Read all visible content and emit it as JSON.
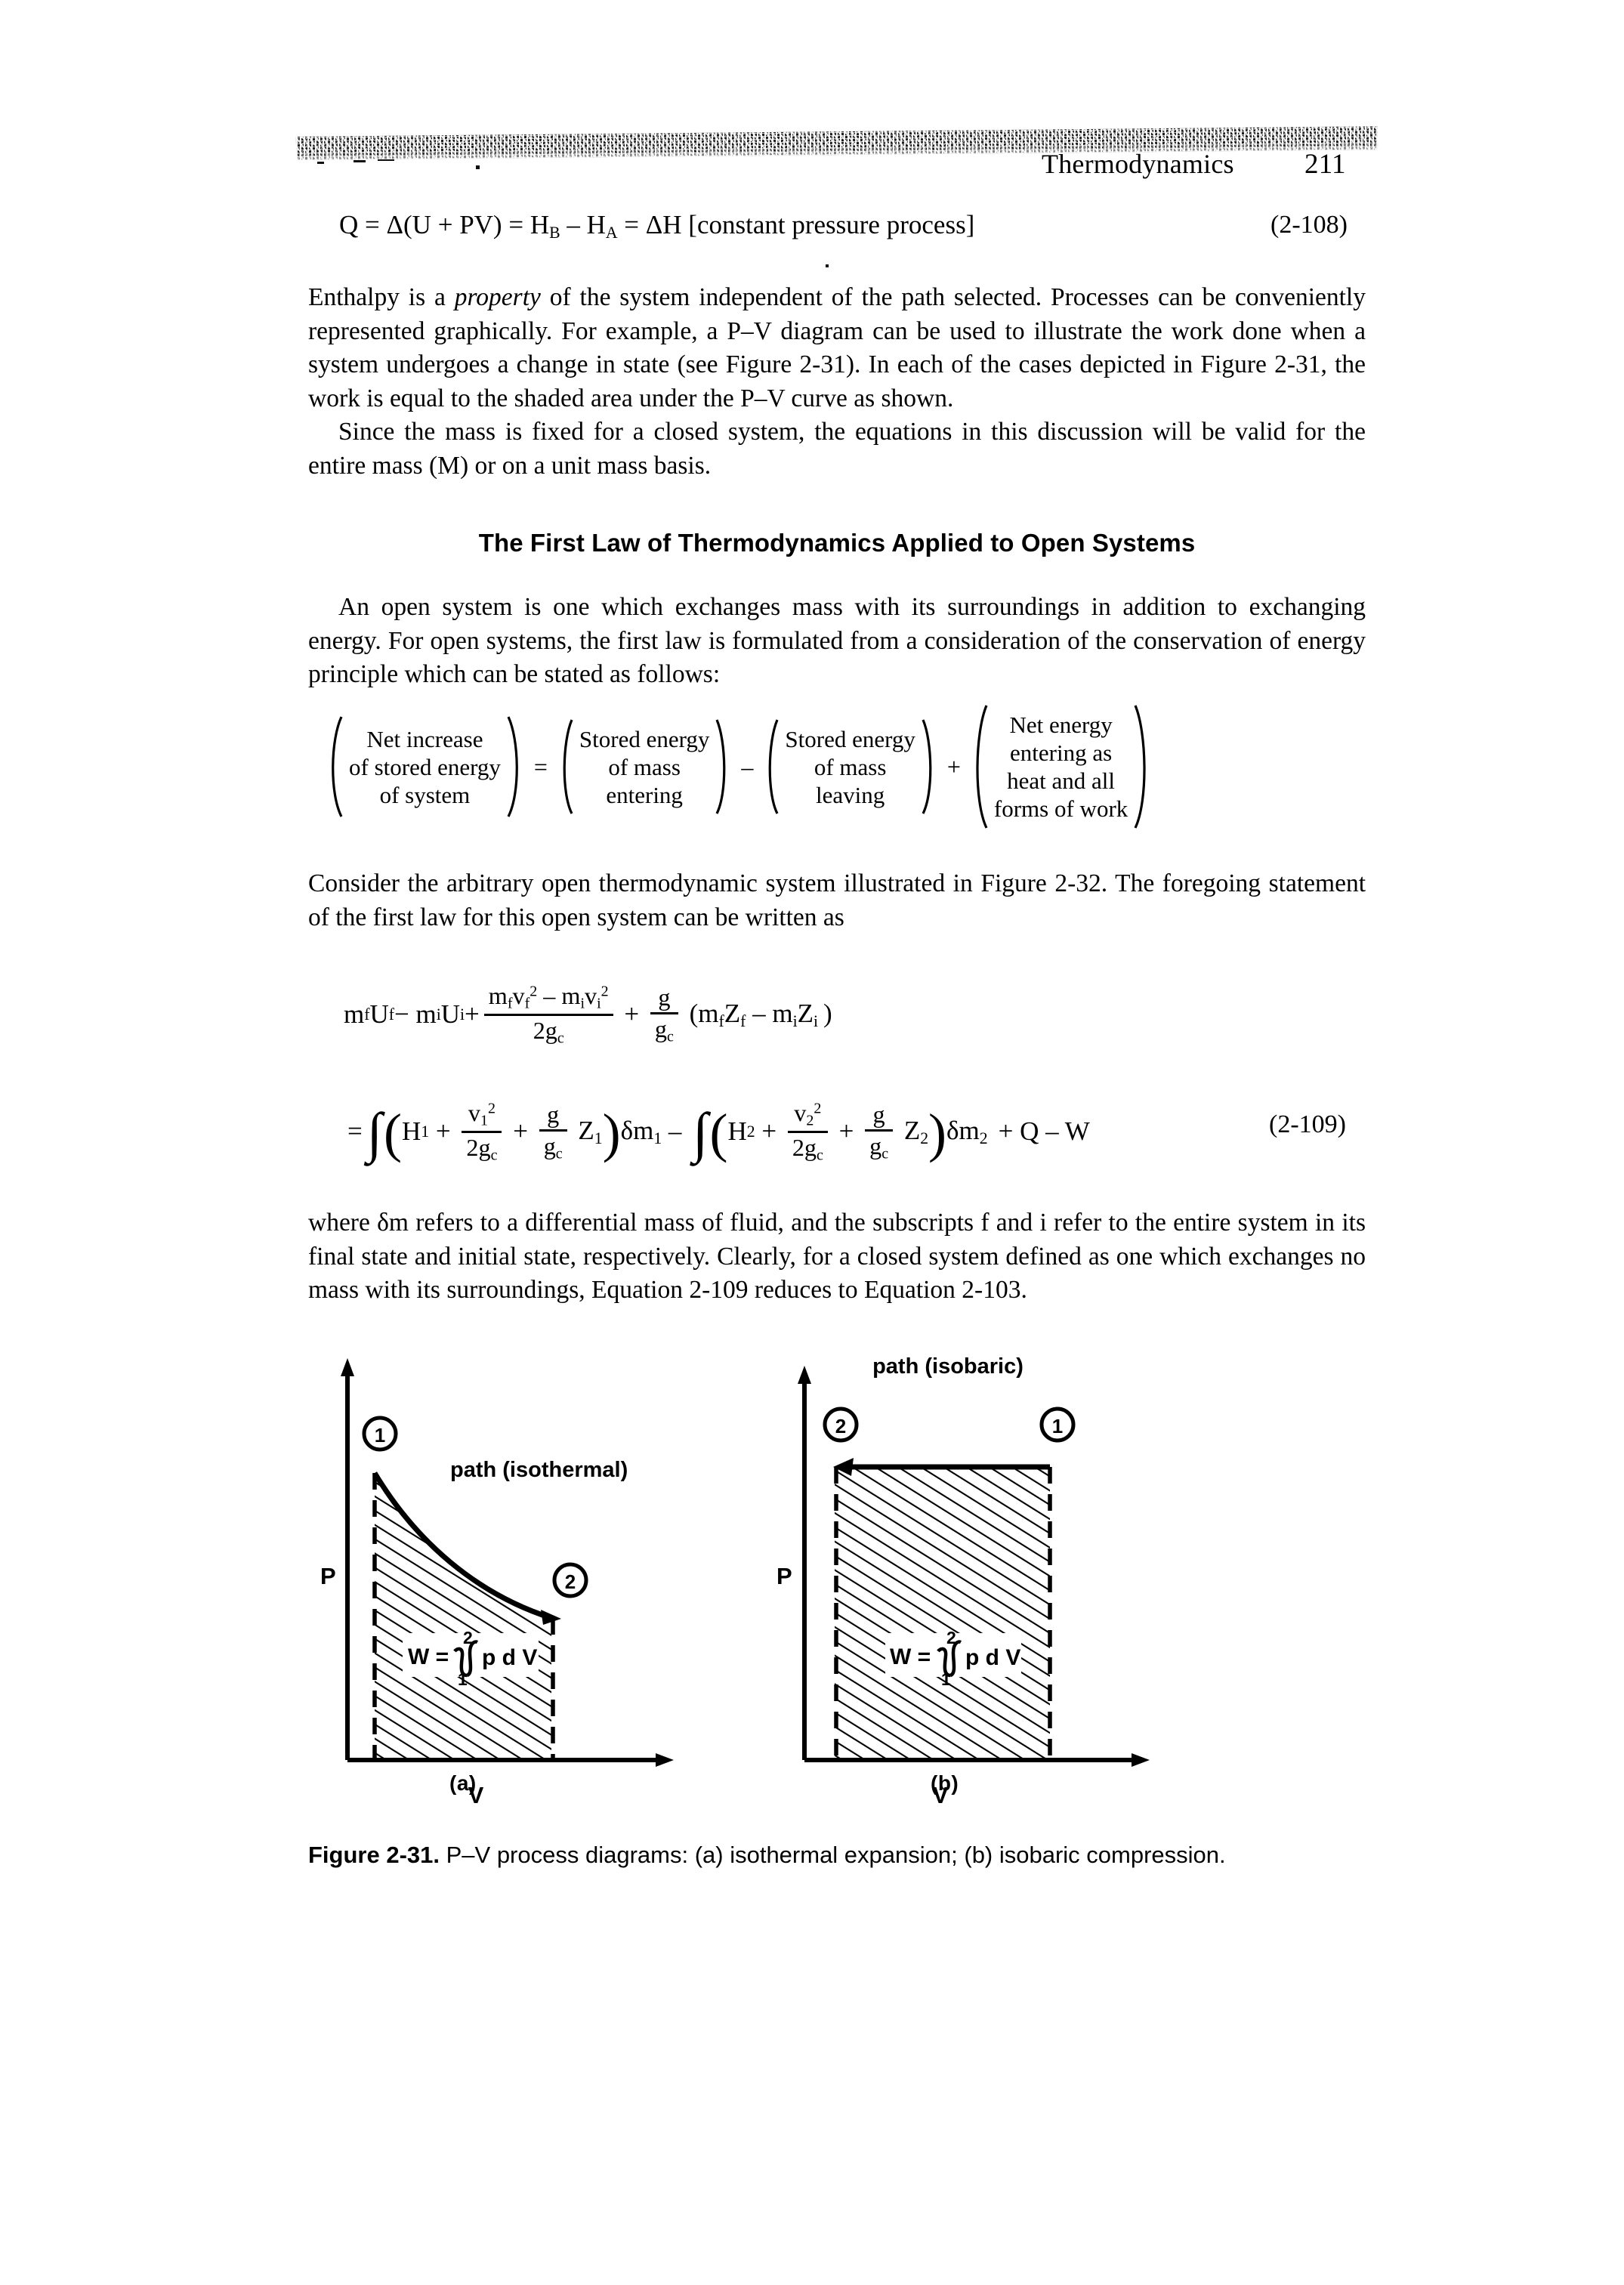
{
  "page": {
    "running_head": "Thermodynamics",
    "page_number": "211"
  },
  "equations": {
    "eq_2_108": {
      "text": "Q = Δ(U + PV) = H_B − H_A = ΔH [constant pressure process]",
      "lead": "Q = Δ(U + PV) = H",
      "sub_b": "B",
      "minus": " – H",
      "sub_a": "A",
      "tail": " = ΔH [constant pressure process]",
      "number": "(2-108)"
    },
    "eq_2_109": {
      "number": "(2-109)",
      "line1": {
        "t1": "m",
        "s1": "f",
        "t2": "U",
        "s2": "f",
        "t3": " − m",
        "s3": "i",
        "t4": "U",
        "s4": "i",
        "t5": " + ",
        "frac_num": "m_f v_f² − m_i v_i²",
        "frac_den": "2g_c",
        "t6": " + ",
        "frac2_num": "g",
        "frac2_den": "g_c",
        "t7": "(m_f Z_f − m_i Z_i)"
      },
      "line2": {
        "equals": "=",
        "integral": "∫",
        "h1": "H",
        "h1sub": "1",
        "f1num": "v₁²",
        "f1den": "2g_c",
        "f2num": "g",
        "f2den": "g_c",
        "z1": "Z",
        "z1sub": "1",
        "dm1": "δm",
        "dm1sub": "1",
        "minus": "−",
        "h2": "H",
        "h2sub": "2",
        "f3num": "v₂²",
        "f3den": "2g_c",
        "f4num": "g",
        "f4den": "g_c",
        "z2": "Z",
        "z2sub": "2",
        "dm2": "δm",
        "dm2sub": "2",
        "tail": "+ Q – W"
      }
    }
  },
  "word_equation": {
    "groups": [
      {
        "lines": [
          "Net  increase",
          "of  stored energy",
          "of system"
        ]
      },
      {
        "lines": [
          "Stored energy",
          "of mass",
          "entering"
        ]
      },
      {
        "lines": [
          "Stored energy",
          "of mass",
          "leaving"
        ]
      },
      {
        "lines": [
          "Net energy",
          "entering as",
          "heat and all",
          "forms of work"
        ]
      }
    ],
    "operators": [
      "=",
      "–",
      "+"
    ]
  },
  "body": {
    "para1": "Enthalpy is a property of the system independent of the path selected. Processes can be conveniently represented graphically. For example, a P–V diagram can be used to illustrate the work done when a system undergoes a change in state (see Figure 2-31). In each of the cases depicted in Figure 2-31, the work is equal to the shaded area under the P–V curve as shown.",
    "para1_pre": "Enthalpy is a ",
    "para1_italic": "property",
    "para1_post": " of the system independent of the path selected. Processes can be conveniently represented graphically. For example, a P–V diagram can be used to illustrate the work done when a system undergoes a change in state (see Figure 2-31). In each of the cases depicted in Figure 2-31, the work is equal to the shaded area under the P–V curve as shown.",
    "para2": "Since the mass is fixed for a closed system, the equations in this discussion will be valid for the entire mass (M) or on a unit mass basis.",
    "heading": "The First Law of Thermodynamics Applied to Open Systems",
    "para3": "An open system is one which exchanges mass with its surroundings in addition to exchanging energy. For open systems, the first law is formulated from a consideration of the conservation of energy principle which can be stated as follows:",
    "para4": "Consider the arbitrary open thermodynamic system illustrated in Figure 2-32. The foregoing statement of the first law for this open system can be written as",
    "para5": "where δm refers to a differential mass of fluid, and the subscripts f and i refer to the entire system in its final state and initial state, respectively. Clearly, for a closed system defined as one which exchanges no mass with its surroundings, Equation 2-109 reduces to Equation 2-103."
  },
  "figure": {
    "caption_bold": "Figure 2-31.",
    "caption_rest": " P–V process diagrams: (a) isothermal expansion; (b) isobaric compression.",
    "panel_a": {
      "sublabel": "(a)",
      "path_label": "path (isothermal)",
      "y_axis_label": "P",
      "x_axis_label": "V",
      "state_start": "1",
      "state_end": "2",
      "work_label": "W =",
      "integral_upper": "2",
      "integral_lower": "1",
      "integrand": "p d V"
    },
    "panel_b": {
      "sublabel": "(b)",
      "path_label": "path (isobaric)",
      "y_axis_label": "P",
      "x_axis_label": "V",
      "state_start": "1",
      "state_end": "2",
      "work_label": "W =",
      "integral_upper": "2",
      "integral_lower": "1",
      "integrand": "p d V"
    }
  },
  "colors": {
    "ink": "#000000",
    "paper": "#ffffff"
  }
}
